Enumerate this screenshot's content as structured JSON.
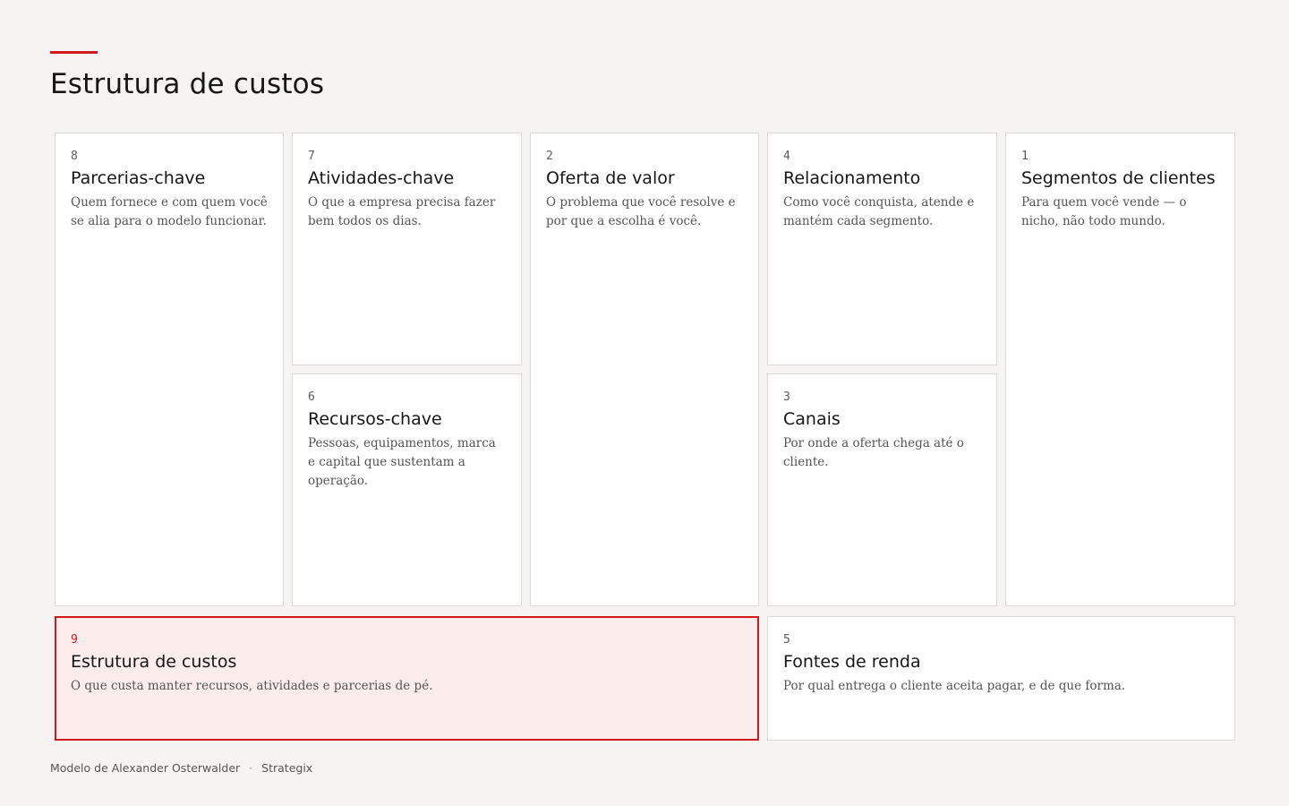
{
  "page": {
    "title": "Estrutura de custos"
  },
  "blocks": {
    "parcerias": {
      "number": "8",
      "title": "Parcerias-chave",
      "description": "Quem fornece e com quem você se alia para o modelo funcionar."
    },
    "atividades": {
      "number": "7",
      "title": "Atividades-chave",
      "description": "O que a empresa precisa fazer bem todos os dias."
    },
    "recursos": {
      "number": "6",
      "title": "Recursos-chave",
      "description": "Pessoas, equipamentos, marca e capital que sustentam a operação."
    },
    "oferta": {
      "number": "2",
      "title": "Oferta de valor",
      "description": "O problema que você resolve e por que a escolha é você."
    },
    "relacionamento": {
      "number": "4",
      "title": "Relacionamento",
      "description": "Como você conquista, atende e mantém cada segmento."
    },
    "canais": {
      "number": "3",
      "title": "Canais",
      "description": "Por onde a oferta chega até o cliente."
    },
    "segmentos": {
      "number": "1",
      "title": "Segmentos de clientes",
      "description": "Para quem você vende — o nicho, não todo mundo."
    },
    "custos": {
      "number": "9",
      "title": "Estrutura de custos",
      "description": "O que custa manter recursos, atividades e parcerias de pé."
    },
    "receitas": {
      "number": "5",
      "title": "Fontes de renda",
      "description": "Por qual entrega o cliente aceita pagar, e de que forma."
    }
  },
  "footer": {
    "credit": "Modelo de Alexander Osterwalder",
    "separator": "·",
    "brand": "Strategix"
  },
  "colors": {
    "accent": "#d0191b",
    "active_background": "#fdecec",
    "page_background": "#f5f4f2"
  }
}
